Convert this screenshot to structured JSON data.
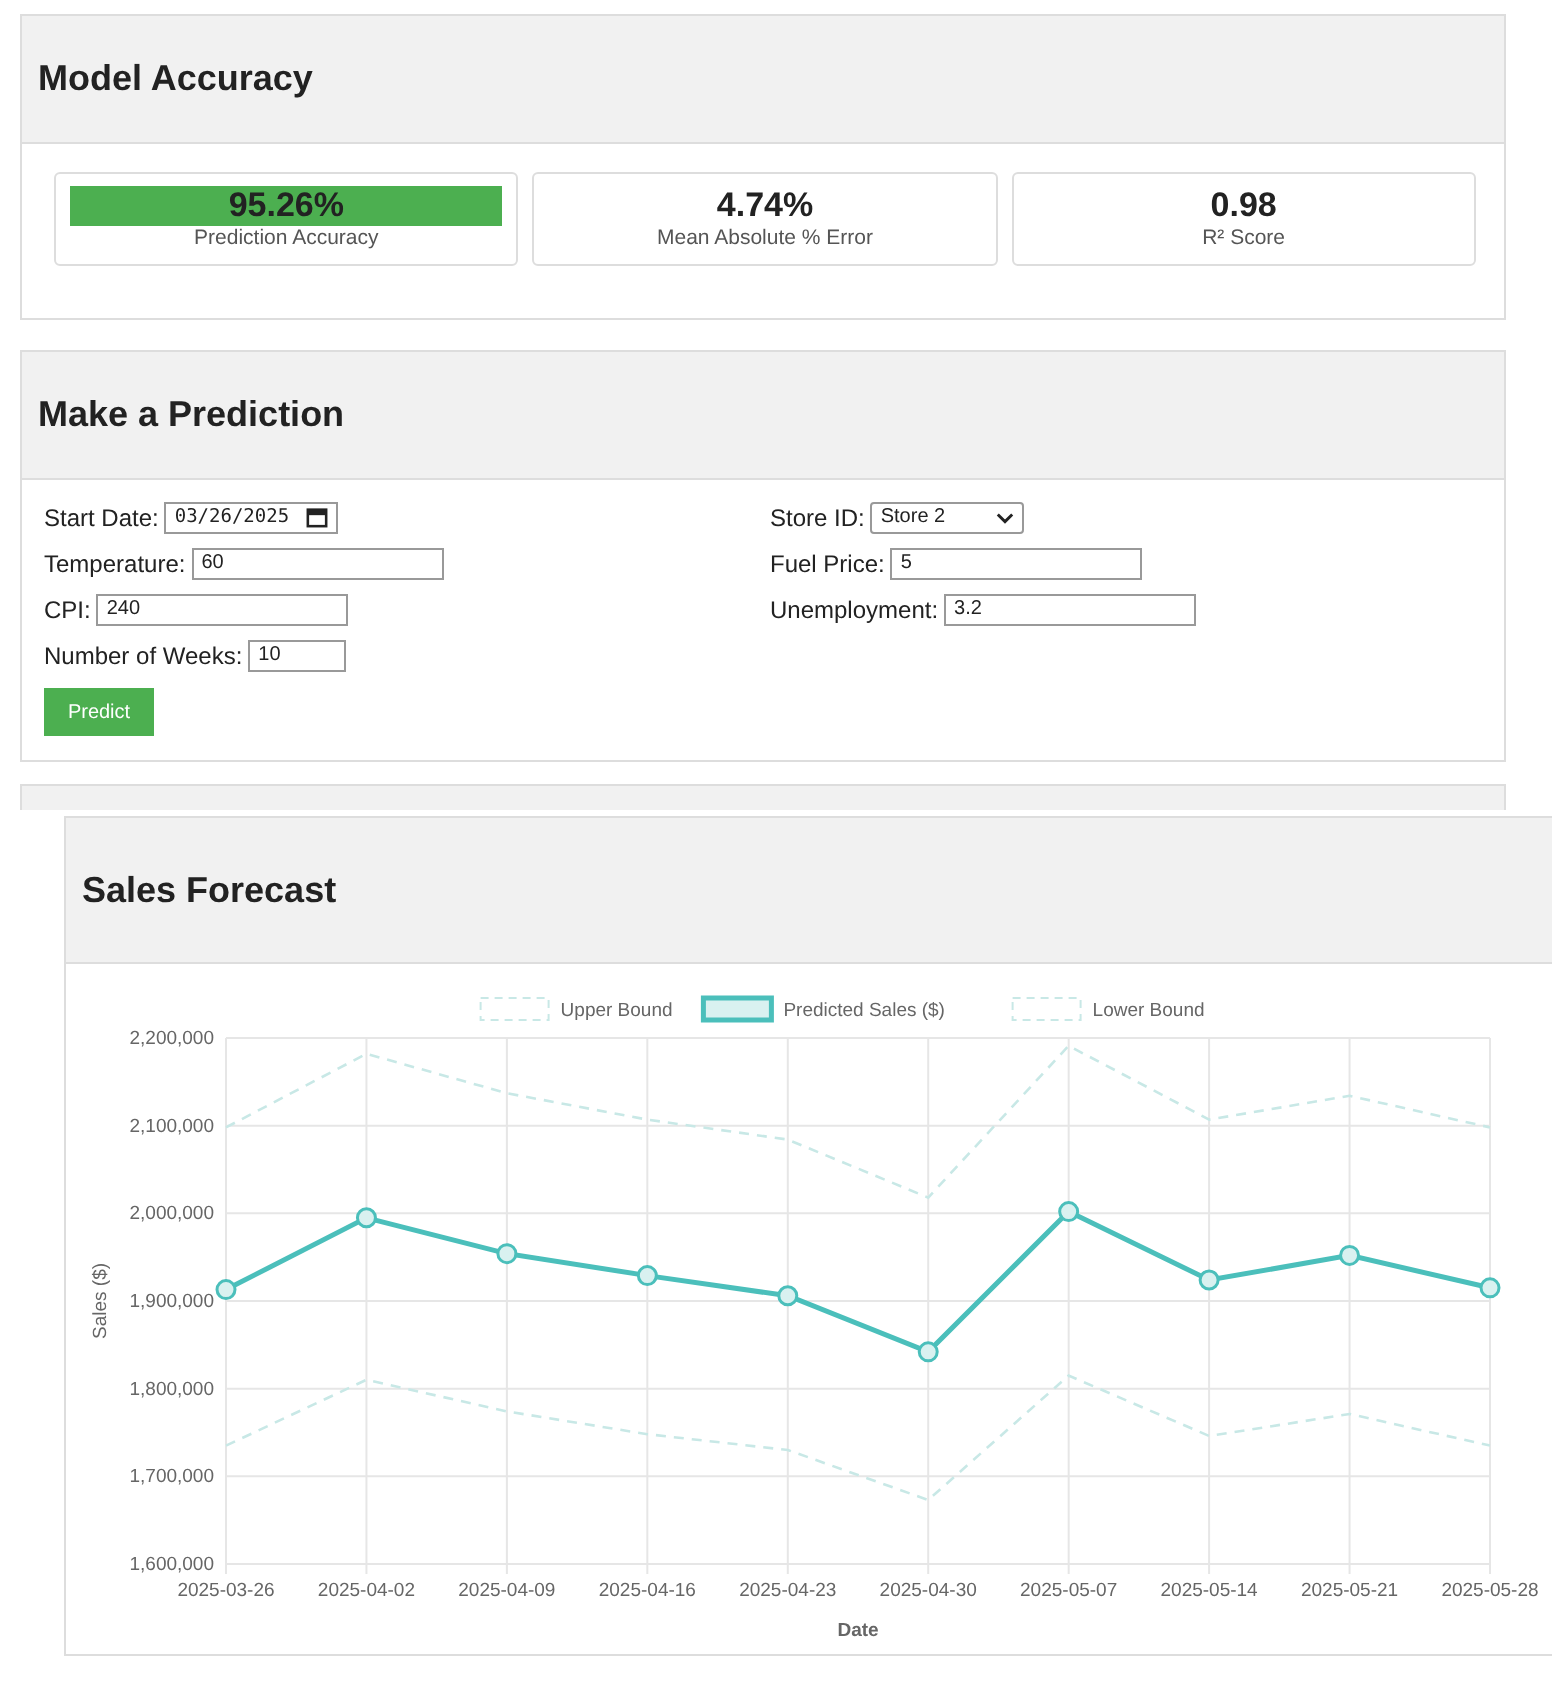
{
  "accuracy_card": {
    "title": "Model Accuracy",
    "metrics": [
      {
        "value": "95.26%",
        "label": "Prediction Accuracy",
        "highlighted": true
      },
      {
        "value": "4.74%",
        "label": "Mean Absolute % Error",
        "highlighted": false
      },
      {
        "value": "0.98",
        "label": "R² Score",
        "highlighted": false
      }
    ]
  },
  "prediction_card": {
    "title": "Make a Prediction",
    "fields": [
      {
        "kind": "date",
        "label": "Start Date:",
        "value": "03/26/2025"
      },
      {
        "kind": "select",
        "label": "Store ID:",
        "value": "Store 2"
      },
      {
        "kind": "text",
        "label": "Temperature:",
        "value": "60"
      },
      {
        "kind": "text",
        "label": "Fuel Price:",
        "value": "5"
      },
      {
        "kind": "text",
        "label": "CPI:",
        "value": "240"
      },
      {
        "kind": "text",
        "label": "Unemployment:",
        "value": "3.2"
      },
      {
        "kind": "short",
        "label": "Number of Weeks:",
        "value": "10"
      }
    ],
    "button": "Predict"
  },
  "forecast_card": {
    "title": "Sales Forecast",
    "chart_data": {
      "type": "line",
      "xlabel": "Date",
      "ylabel": "Sales ($)",
      "categories": [
        "2025-03-26",
        "2025-04-02",
        "2025-04-09",
        "2025-04-16",
        "2025-04-23",
        "2025-04-30",
        "2025-05-07",
        "2025-05-14",
        "2025-05-21",
        "2025-05-28"
      ],
      "series": [
        {
          "name": "Upper Bound",
          "color": "#c8e8e6",
          "line_style": "dashed",
          "marker": "none",
          "values": [
            2098000,
            2182000,
            2137000,
            2107000,
            2084000,
            2018000,
            2191000,
            2107000,
            2134000,
            2098000
          ]
        },
        {
          "name": "Predicted Sales ($)",
          "color": "#4bbfbb",
          "line_style": "solid",
          "marker": "circle",
          "values": [
            1913000,
            1995000,
            1954000,
            1929000,
            1906000,
            1842000,
            2002000,
            1924000,
            1952000,
            1915000
          ]
        },
        {
          "name": "Lower Bound",
          "color": "#c8e8e6",
          "line_style": "dashed",
          "marker": "none",
          "values": [
            1735000,
            1810000,
            1774000,
            1748000,
            1730000,
            1673000,
            1815000,
            1746000,
            1771000,
            1735000
          ]
        }
      ],
      "ylim": [
        1600000,
        2200000
      ],
      "grid": true,
      "legend": true,
      "yticks": [
        {
          "value": 1600000,
          "label": "1,600,000"
        },
        {
          "value": 1700000,
          "label": "1,700,000"
        },
        {
          "value": 1800000,
          "label": "1,800,000"
        },
        {
          "value": 1900000,
          "label": "1,900,000"
        },
        {
          "value": 2000000,
          "label": "2,000,000"
        },
        {
          "value": 2100000,
          "label": "2,100,000"
        },
        {
          "value": 2200000,
          "label": "2,200,000"
        }
      ]
    }
  }
}
